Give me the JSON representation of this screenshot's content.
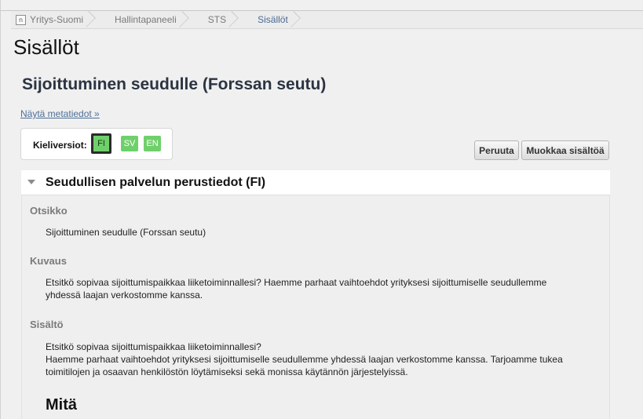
{
  "breadcrumb": {
    "home_icon": "n",
    "items": [
      "Yritys-Suomi",
      "Hallintapaneeli",
      "STS",
      "Sisällöt"
    ]
  },
  "page": {
    "title": "Sisällöt"
  },
  "content": {
    "title": "Sijoittuminen seudulle (Forssan seutu)",
    "meta_link": "Näytä metatiedot »"
  },
  "languages": {
    "label": "Kieliversiot:",
    "items": [
      "FI",
      "SV",
      "EN"
    ],
    "active": "FI"
  },
  "actions": {
    "cancel": "Peruuta",
    "edit": "Muokkaa sisältöä"
  },
  "panel": {
    "title": "Seudullisen palvelun perustiedot (FI)",
    "fields": [
      {
        "label": "Otsikko",
        "lines": [
          "Sijoittuminen seudulle (Forssan seutu)"
        ]
      },
      {
        "label": "Kuvaus",
        "lines": [
          "Etsitkö sopivaa sijoittumispaikkaa liiketoiminnallesi? Haemme parhaat vaihtoehdot yrityksesi sijoittumiselle seudullemme",
          "yhdessä laajan verkostomme kanssa."
        ]
      },
      {
        "label": "Sisältö",
        "lines": [
          "Etsitkö sopivaa sijoittumispaikkaa liiketoiminnallesi?",
          "Haemme parhaat vaihtoehdot yrityksesi sijoittumiselle seudullemme yhdessä laajan verkostomme kanssa. Tarjoamme tukea",
          "toimitilojen ja osaavan henkilöstön löytämiseksi sekä monissa käytännön järjestelyissä."
        ]
      }
    ],
    "subheading": "Mitä"
  },
  "colors": {
    "lang_button": "#6fd06b",
    "link": "#4d6f96",
    "breadcrumb_current": "#4a6a91"
  }
}
